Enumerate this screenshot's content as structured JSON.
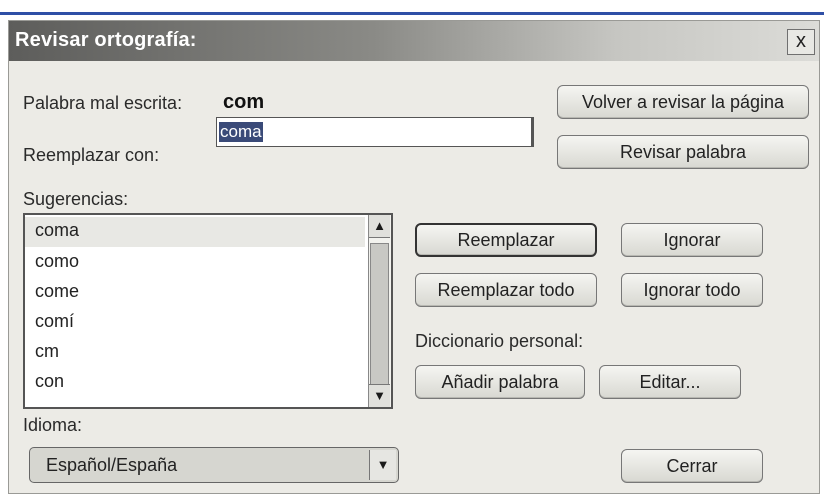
{
  "dialog": {
    "title": "Revisar ortografía:",
    "close_label": "x"
  },
  "misspelled": {
    "label": "Palabra mal escrita:",
    "word": "com"
  },
  "replace_with": {
    "label": "Reemplazar con:",
    "value": "coma"
  },
  "suggestions": {
    "label": "Sugerencias:",
    "items": [
      "coma",
      "como",
      "come",
      "comí",
      "cm",
      "con"
    ]
  },
  "buttons": {
    "recheck_page": "Volver a revisar la página",
    "check_word": "Revisar palabra",
    "replace": "Reemplazar",
    "ignore": "Ignorar",
    "replace_all": "Reemplazar todo",
    "ignore_all": "Ignorar todo",
    "add_word": "Añadir palabra",
    "edit": "Editar...",
    "close": "Cerrar"
  },
  "personal_dictionary": {
    "label": "Diccionario personal:"
  },
  "language": {
    "label": "Idioma:",
    "selected": "Español/España"
  },
  "colors": {
    "accent": "#2f4fa6",
    "selection": "#3a4a78"
  }
}
